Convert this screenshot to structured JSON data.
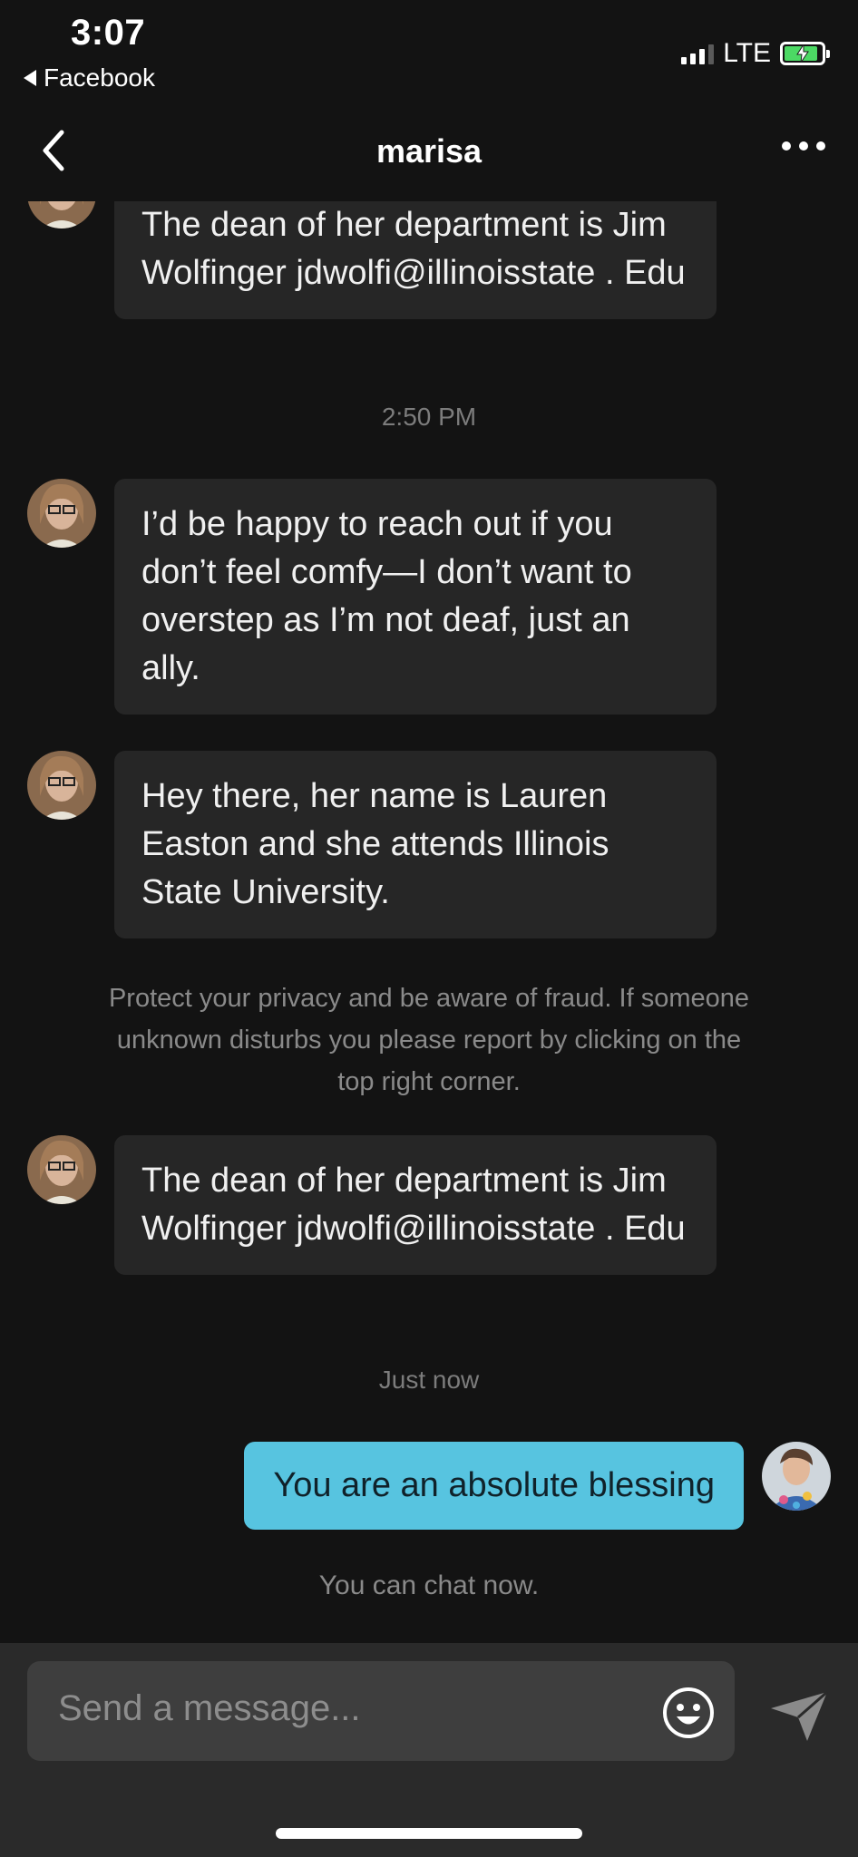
{
  "status_bar": {
    "time": "3:07",
    "back_app": "Facebook",
    "network": "LTE"
  },
  "header": {
    "title": "marisa"
  },
  "messages": [
    {
      "sender": "marisa",
      "text": "The dean of her department is Jim Wolfinger jdwolfi@illinoisstate . Edu"
    },
    {
      "sender": "marisa",
      "text": "I’d be happy to reach out if you don’t feel comfy—I don’t want to overstep as I’m not deaf, just an ally."
    },
    {
      "sender": "marisa",
      "text": "Hey there, her name is Lauren Easton and she attends Illinois State University."
    },
    {
      "sender": "marisa",
      "text": "The dean of her department is Jim Wolfinger jdwolfi@illinoisstate . Edu"
    },
    {
      "sender": "me",
      "text": "You are an absolute blessing"
    }
  ],
  "timestamps": [
    "2:50 PM",
    "Just now"
  ],
  "notices": {
    "privacy": "Protect your privacy and be aware of fraud. If someone unknown disturbs you please report by clicking on the top right corner.",
    "chat_ready": "You can chat now."
  },
  "composer": {
    "placeholder": "Send a message..."
  },
  "colors": {
    "background": "#131313",
    "bubble_incoming": "#262626",
    "bubble_outgoing": "#57c4e0",
    "battery": "#4cd964"
  }
}
